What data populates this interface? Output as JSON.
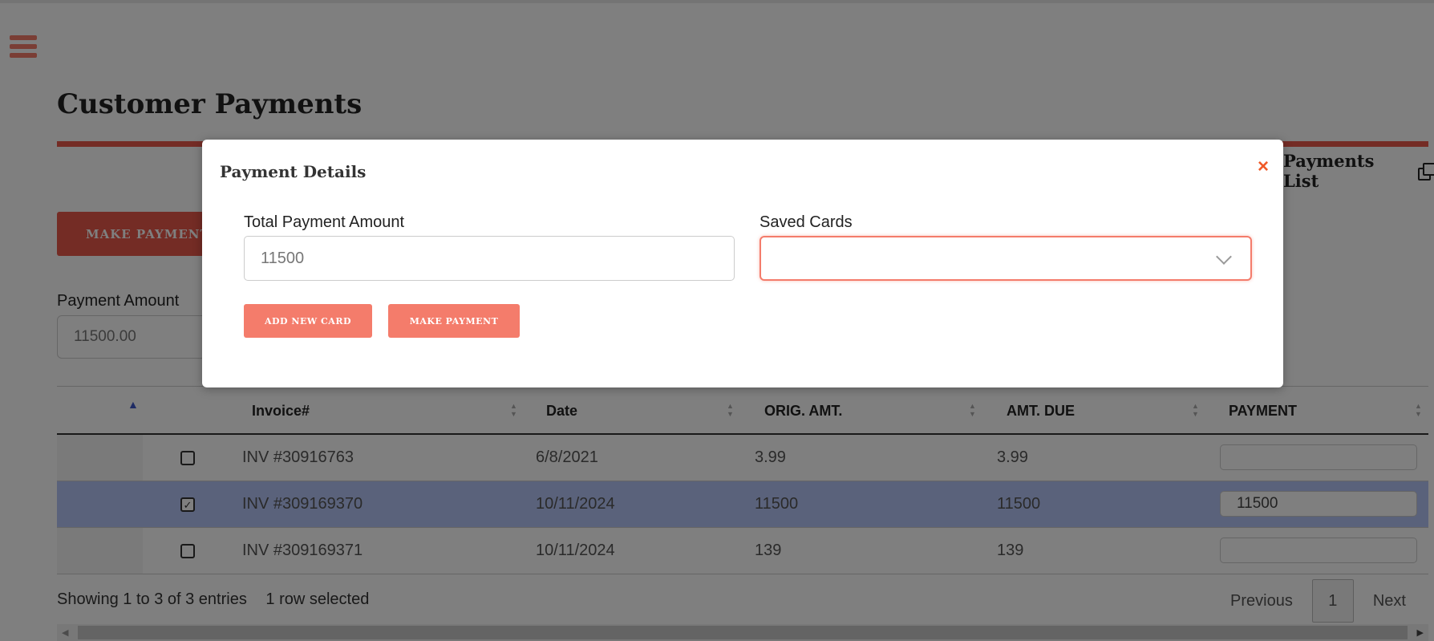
{
  "page": {
    "title": "Customer Payments",
    "payments_list_label": "Payments List",
    "make_payment_label": "MAKE PAYMENT",
    "payment_amount_label": "Payment Amount",
    "payment_amount_value": "11500.00"
  },
  "table": {
    "headers": [
      "Invoice#",
      "Date",
      "ORIG. AMT.",
      "AMT. DUE",
      "PAYMENT"
    ],
    "rows": [
      {
        "invoice": "INV #30916763",
        "date": "6/8/2021",
        "orig": "3.99",
        "due": "3.99",
        "payment": "",
        "selected": false
      },
      {
        "invoice": "INV #309169370",
        "date": "10/11/2024",
        "orig": "11500",
        "due": "11500",
        "payment": "11500",
        "selected": true
      },
      {
        "invoice": "INV #309169371",
        "date": "10/11/2024",
        "orig": "139",
        "due": "139",
        "payment": "",
        "selected": false
      }
    ],
    "showing": "Showing 1 to 3 of 3 entries",
    "selected_info": "1 row selected",
    "pager": {
      "previous": "Previous",
      "page": "1",
      "next": "Next"
    }
  },
  "modal": {
    "title": "Payment Details",
    "close_icon": "×",
    "total_label": "Total Payment Amount",
    "total_value": "11500",
    "saved_cards_label": "Saved Cards",
    "saved_cards_value": "",
    "add_card_label": "ADD NEW CARD",
    "make_payment_label": "MAKE PAYMENT"
  },
  "colors": {
    "accent": "#f47c6b",
    "accent_dark": "#e8584a",
    "close": "#f05a28",
    "row_selected": "#b5c5f6"
  }
}
